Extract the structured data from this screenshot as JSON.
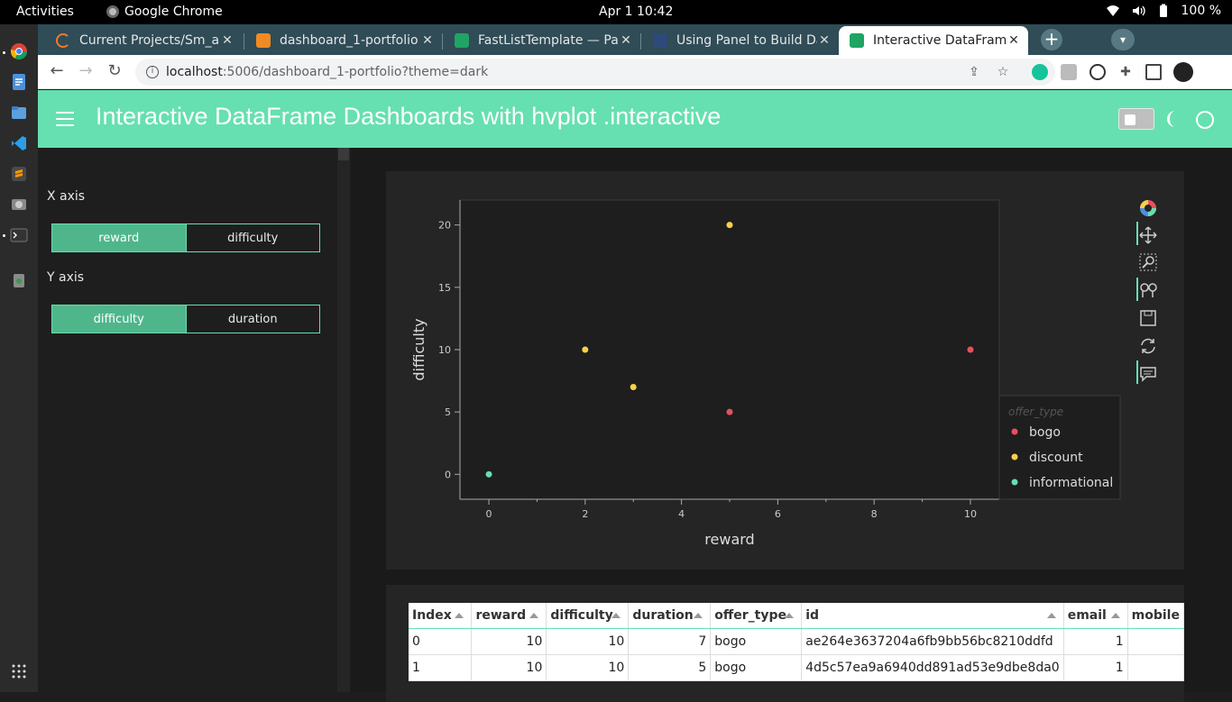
{
  "topbar": {
    "activities": "Activities",
    "app_name": "Google Chrome",
    "clock": "Apr 1  10:42",
    "battery": "100 %"
  },
  "tabs": [
    {
      "title": "Current Projects/Sm_a",
      "icon": "spinner-icon",
      "color": "#f07a2c"
    },
    {
      "title": "dashboard_1-portfolio",
      "icon": "jupyter-book-icon",
      "color": "#f08a24"
    },
    {
      "title": "FastListTemplate — Pa",
      "icon": "sheets-icon",
      "color": "#1fa463"
    },
    {
      "title": "Using Panel to Build Da",
      "icon": "tds-icon",
      "color": "#2d4a7a"
    },
    {
      "title": "Interactive DataFrame",
      "icon": "sheets-icon",
      "color": "#1fa463",
      "active": true
    }
  ],
  "address_bar": {
    "host": "localhost",
    "path": ":5006/dashboard_1-portfolio?theme=dark"
  },
  "header": {
    "title": "Interactive DataFrame Dashboards with hvplot .interactive",
    "accent": "#66e0b0"
  },
  "sidebar": {
    "x_axis_label": "X axis",
    "x_options": [
      "reward",
      "difficulty"
    ],
    "x_selected": "reward",
    "y_axis_label": "Y axis",
    "y_options": [
      "difficulty",
      "duration"
    ],
    "y_selected": "difficulty"
  },
  "chart_data": {
    "type": "scatter",
    "xlabel": "reward",
    "ylabel": "difficulty",
    "xlim": [
      -0.6,
      10.6
    ],
    "ylim": [
      -2,
      22
    ],
    "xticks": [
      0,
      2,
      4,
      6,
      8,
      10
    ],
    "yticks": [
      0,
      5,
      10,
      15,
      20
    ],
    "legend_title": "offer_type",
    "legend_position": "right",
    "series": [
      {
        "name": "bogo",
        "color": "#e8505b",
        "points": [
          [
            10,
            10
          ],
          [
            5,
            5
          ]
        ]
      },
      {
        "name": "discount",
        "color": "#f7d147",
        "points": [
          [
            5,
            20
          ],
          [
            2,
            10
          ],
          [
            3,
            7
          ]
        ]
      },
      {
        "name": "informational",
        "color": "#66e0b0",
        "points": [
          [
            0,
            0
          ]
        ]
      }
    ]
  },
  "table": {
    "columns": [
      "Index",
      "reward",
      "difficulty",
      "duration",
      "offer_type",
      "id",
      "email",
      "mobile"
    ],
    "rows": [
      [
        "0",
        "10",
        "10",
        "7",
        "bogo",
        "ae264e3637204a6fb9bb56bc8210ddfd",
        "1",
        ""
      ],
      [
        "1",
        "10",
        "10",
        "5",
        "bogo",
        "4d5c57ea9a6940dd891ad53e9dbe8da0",
        "1",
        ""
      ]
    ]
  }
}
